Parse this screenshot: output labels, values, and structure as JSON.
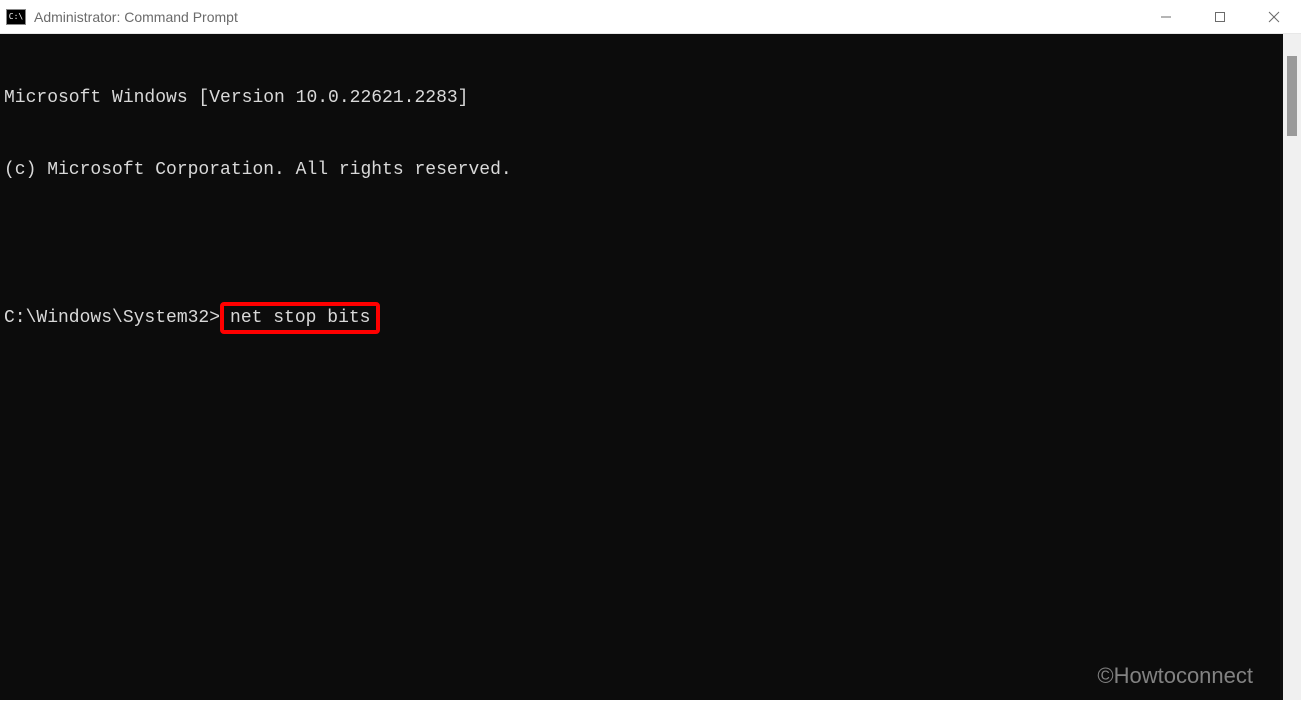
{
  "window": {
    "title": "Administrator: Command Prompt",
    "icon_label": "C:\\"
  },
  "terminal": {
    "line1": "Microsoft Windows [Version 10.0.22621.2283]",
    "line2": "(c) Microsoft Corporation. All rights reserved.",
    "prompt_path": "C:\\Windows\\System32>",
    "command": "net stop bits"
  },
  "watermark": "©Howtoconnect"
}
